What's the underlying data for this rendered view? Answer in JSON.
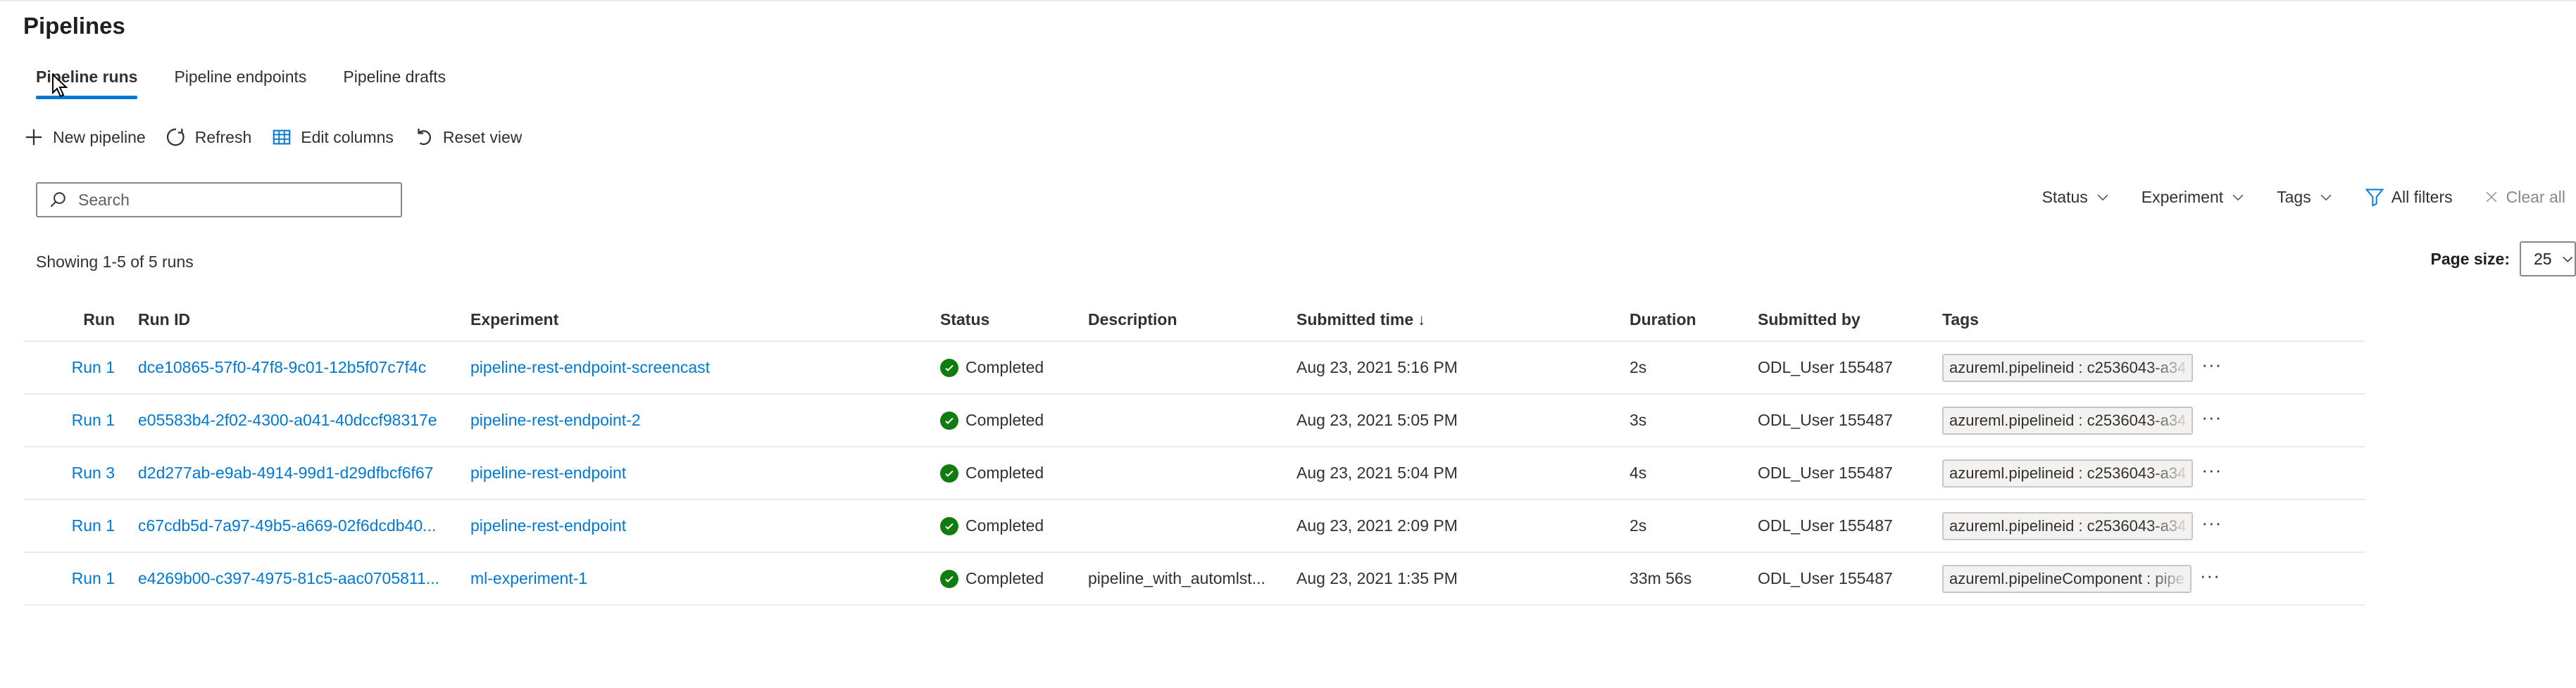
{
  "page": {
    "title": "Pipelines"
  },
  "tabs": [
    {
      "label": "Pipeline runs",
      "active": true
    },
    {
      "label": "Pipeline endpoints",
      "active": false
    },
    {
      "label": "Pipeline drafts",
      "active": false
    }
  ],
  "toolbar": {
    "new_pipeline": "New pipeline",
    "refresh": "Refresh",
    "edit_columns": "Edit columns",
    "reset_view": "Reset view"
  },
  "search": {
    "placeholder": "Search",
    "value": ""
  },
  "filters": {
    "status": "Status",
    "experiment": "Experiment",
    "tags": "Tags",
    "all_filters": "All filters",
    "clear_all": "Clear all"
  },
  "summary": {
    "showing": "Showing 1-5 of 5 runs"
  },
  "pagination": {
    "label": "Page size:",
    "value": "25"
  },
  "table": {
    "columns": [
      "Run",
      "Run ID",
      "Experiment",
      "Status",
      "Description",
      "Submitted time",
      "Duration",
      "Submitted by",
      "Tags"
    ],
    "sort_indicator": "↓",
    "rows": [
      {
        "run": "Run 1",
        "run_id": "dce10865-57f0-47f8-9c01-12b5f07c7f4c",
        "experiment": "pipeline-rest-endpoint-screencast",
        "status": "Completed",
        "description": "",
        "submitted_time": "Aug 23, 2021 5:16 PM",
        "duration": "2s",
        "submitted_by": "ODL_User 155487",
        "tag": "azureml.pipelineid : c2536043-a34"
      },
      {
        "run": "Run 1",
        "run_id": "e05583b4-2f02-4300-a041-40dccf98317e",
        "experiment": "pipeline-rest-endpoint-2",
        "status": "Completed",
        "description": "",
        "submitted_time": "Aug 23, 2021 5:05 PM",
        "duration": "3s",
        "submitted_by": "ODL_User 155487",
        "tag": "azureml.pipelineid : c2536043-a34"
      },
      {
        "run": "Run 3",
        "run_id": "d2d277ab-e9ab-4914-99d1-d29dfbcf6f67",
        "experiment": "pipeline-rest-endpoint",
        "status": "Completed",
        "description": "",
        "submitted_time": "Aug 23, 2021 5:04 PM",
        "duration": "4s",
        "submitted_by": "ODL_User 155487",
        "tag": "azureml.pipelineid : c2536043-a34"
      },
      {
        "run": "Run 1",
        "run_id": "c67cdb5d-7a97-49b5-a669-02f6dcdb40...",
        "experiment": "pipeline-rest-endpoint",
        "status": "Completed",
        "description": "",
        "submitted_time": "Aug 23, 2021 2:09 PM",
        "duration": "2s",
        "submitted_by": "ODL_User 155487",
        "tag": "azureml.pipelineid : c2536043-a34"
      },
      {
        "run": "Run 1",
        "run_id": "e4269b00-c397-4975-81c5-aac0705811...",
        "experiment": "ml-experiment-1",
        "status": "Completed",
        "description": "pipeline_with_automlst...",
        "submitted_time": "Aug 23, 2021 1:35 PM",
        "duration": "33m 56s",
        "submitted_by": "ODL_User 155487",
        "tag": "azureml.pipelineComponent : pipe"
      }
    ]
  },
  "icons": {
    "plus": "plus-icon",
    "refresh": "refresh-icon",
    "columns": "edit-columns-icon",
    "reset": "reset-icon",
    "search": "search-icon",
    "filter": "filter-icon",
    "clear": "close-icon",
    "chevron": "chevron-down-icon",
    "success": "checkmark-circle-icon",
    "more": "more-icon"
  },
  "colors": {
    "accent": "#0078d4",
    "success": "#107c10",
    "text": "#323130"
  }
}
